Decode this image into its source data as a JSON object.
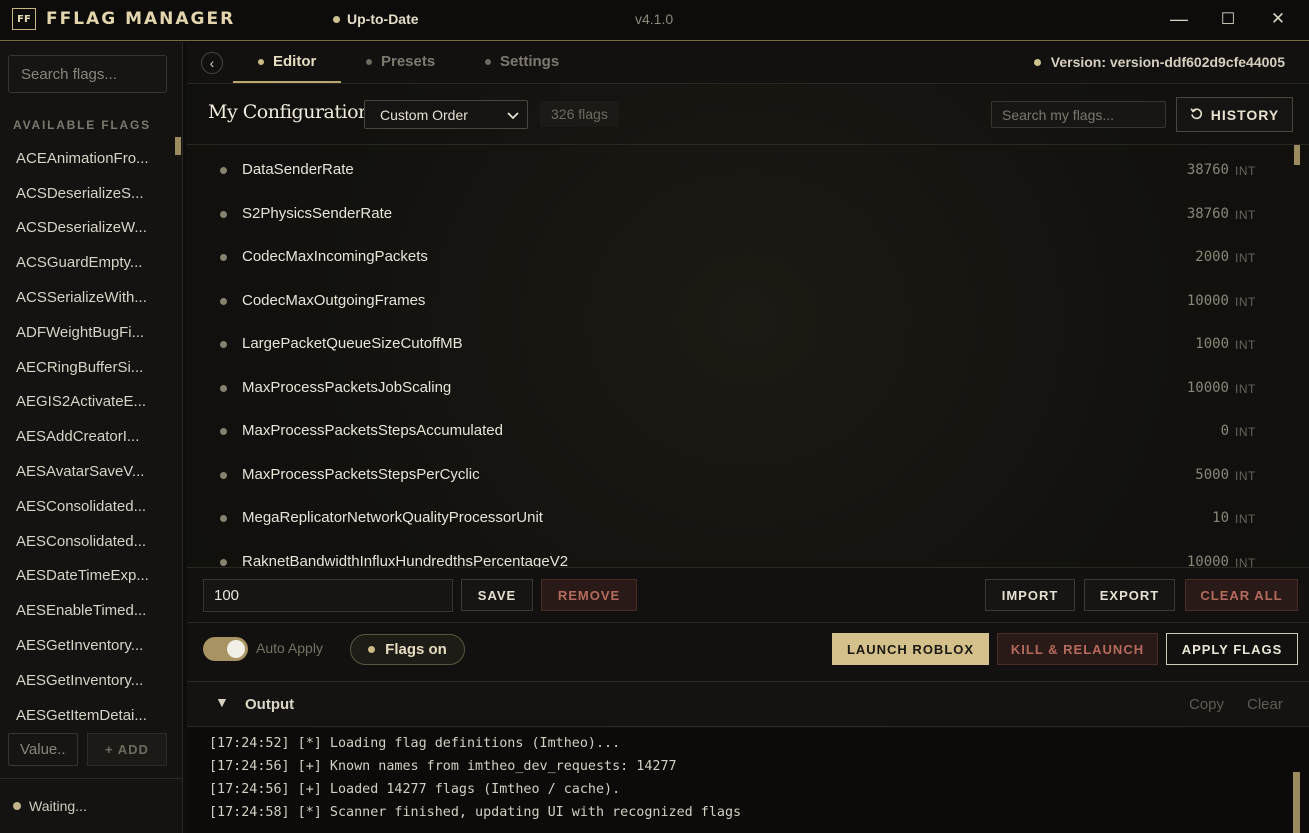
{
  "titlebar": {
    "logo": "FF",
    "app_name": "FFLAG MANAGER",
    "status": "Up-to-Date",
    "version": "v4.1.0",
    "minimize": "—",
    "maximize": "☐",
    "close": "✕"
  },
  "sidebar": {
    "search_placeholder": "Search flags...",
    "heading": "AVAILABLE FLAGS",
    "items": [
      "ACEAnimationFro...",
      "ACSDeserializeS...",
      "ACSDeserializeW...",
      "ACSGuardEmpty...",
      "ACSSerializeWith...",
      "ADFWeightBugFi...",
      "AECRingBufferSi...",
      "AEGIS2ActivateE...",
      "AESAddCreatorI...",
      "AESAvatarSaveV...",
      "AESConsolidated...",
      "AESConsolidated...",
      "AESDateTimeExp...",
      "AESEnableTimed...",
      "AESGetInventory...",
      "AESGetInventory...",
      "AESGetItemDetai..."
    ],
    "value_placeholder": "Value..",
    "add_label": "+ ADD",
    "status": "Waiting..."
  },
  "tabs": {
    "back": "‹",
    "items": [
      {
        "label": "Editor",
        "active": true
      },
      {
        "label": "Presets",
        "active": false
      },
      {
        "label": "Settings",
        "active": false
      }
    ],
    "version_label": "Version: version-ddf602d9cfe44005"
  },
  "config": {
    "title": "My Configuration",
    "order_selected": "Custom Order",
    "flag_count": "326 flags",
    "search_placeholder": "Search my flags...",
    "history_label": "HISTORY"
  },
  "flags": [
    {
      "name": "DataSenderRate",
      "value": "38760",
      "type": "INT"
    },
    {
      "name": "S2PhysicsSenderRate",
      "value": "38760",
      "type": "INT"
    },
    {
      "name": "CodecMaxIncomingPackets",
      "value": "2000",
      "type": "INT"
    },
    {
      "name": "CodecMaxOutgoingFrames",
      "value": "10000",
      "type": "INT"
    },
    {
      "name": "LargePacketQueueSizeCutoffMB",
      "value": "1000",
      "type": "INT"
    },
    {
      "name": "MaxProcessPacketsJobScaling",
      "value": "10000",
      "type": "INT"
    },
    {
      "name": "MaxProcessPacketsStepsAccumulated",
      "value": "0",
      "type": "INT"
    },
    {
      "name": "MaxProcessPacketsStepsPerCyclic",
      "value": "5000",
      "type": "INT"
    },
    {
      "name": "MegaReplicatorNetworkQualityProcessorUnit",
      "value": "10",
      "type": "INT"
    },
    {
      "name": "RaknetBandwidthInfluxHundredthsPercentageV2",
      "value": "10000",
      "type": "INT"
    }
  ],
  "edit": {
    "value": "100",
    "save": "SAVE",
    "remove": "REMOVE",
    "import": "IMPORT",
    "export": "EXPORT",
    "clear_all": "CLEAR ALL"
  },
  "actions": {
    "auto_apply": "Auto Apply",
    "auto_apply_on": true,
    "flags_on": "Flags on",
    "launch": "LAUNCH ROBLOX",
    "kill": "KILL & RELAUNCH",
    "apply": "APPLY FLAGS"
  },
  "output": {
    "caret": "▼",
    "title": "Output",
    "copy": "Copy",
    "clear": "Clear",
    "lines": [
      "[17:24:52] [*] Loading flag definitions (Imtheo)...",
      "[17:24:56] [+] Known names from imtheo_dev_requests: 14277",
      "[17:24:56] [+] Loaded 14277 flags (Imtheo / cache).",
      "[17:24:58] [*] Scanner finished, updating UI with recognized flags"
    ]
  },
  "colors": {
    "accent_gold": "#d3c08a",
    "danger": "#b46a5c",
    "background": "#0e0d0b"
  }
}
